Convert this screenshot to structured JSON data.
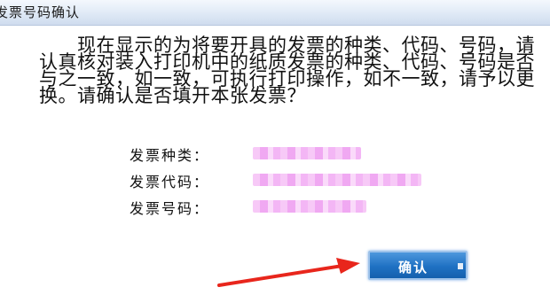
{
  "window": {
    "title": "发票号码确认"
  },
  "message": {
    "text": "　　现在显示的为将要开具的发票的种类、代码、号码，请认真核对装入打印机中的纸质发票的种类、代码、号码是否与之一致，如一致，可执行打印操作，如不一致，请予以更换。请确认是否填开本张发票？"
  },
  "fields": [
    {
      "label": "发票种类：",
      "value_redacted": true
    },
    {
      "label": "发票代码：",
      "value_redacted": true
    },
    {
      "label": "发票号码：",
      "value_redacted": true
    }
  ],
  "buttons": {
    "confirm_label": "确认"
  },
  "annotation": {
    "arrow_color": "#e8261c",
    "target": "confirm-button"
  },
  "colors": {
    "titlebar": "#dfe9f6",
    "button": "#1f71c3",
    "redaction": "#f2aef4"
  }
}
